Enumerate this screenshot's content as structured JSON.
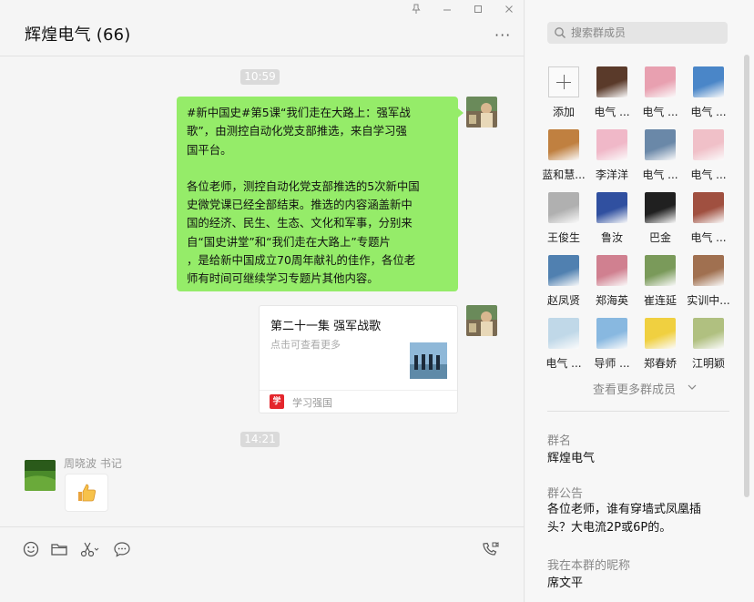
{
  "chat": {
    "title": "辉煌电气 (66)",
    "more_icon": "ellipsis-icon",
    "window_controls": [
      "pin-icon",
      "minimize-icon",
      "maximize-icon",
      "close-icon"
    ],
    "timestamps": [
      "10:59",
      "14:21"
    ],
    "message1": {
      "lines": [
        "#新中国史#第5课“我们走在大路上：强军战",
        "歌”，由测控自动化党支部推选，来自学习强",
        "国平台。",
        "",
        "各位老师，测控自动化党支部推选的5次新中国",
        "史微党课已经全部结束。推选的内容涵盖新中",
        "国的经济、民生、生态、文化和军事，分别来",
        "自“国史讲堂”和“我们走在大路上”专题片",
        "，是给新中国成立70周年献礼的佳作，各位老",
        "师有时间可继续学习专题片其他内容。"
      ]
    },
    "card": {
      "title": "第二十一集 强军战歌",
      "subtitle": "点击可查看更多",
      "source": "学习强国",
      "logo_text": "学"
    },
    "message3": {
      "sender": "周晓波 书记",
      "sticker": "thumbs-up-icon"
    },
    "toolbar_icons": [
      "emoji-icon",
      "folder-icon",
      "scissors-icon",
      "chat-history-icon",
      "video-call-icon"
    ]
  },
  "panel": {
    "search_placeholder": "搜索群成员",
    "add_label": "添加",
    "members": [
      {
        "name": "电气 ...",
        "color": "#5a3a2a"
      },
      {
        "name": "电气 ...",
        "color": "#e8a0b0"
      },
      {
        "name": "电气 ...",
        "color": "#4a86c8"
      },
      {
        "name": "蓝和慧...",
        "color": "#c08040"
      },
      {
        "name": "李洋洋",
        "color": "#f0b8c8"
      },
      {
        "name": "电气 ...",
        "color": "#6a88a8"
      },
      {
        "name": "电气 ...",
        "color": "#f0c0c8"
      },
      {
        "name": "王俊生",
        "color": "#b0b0b0"
      },
      {
        "name": "鲁汝",
        "color": "#3050a0"
      },
      {
        "name": "巴金",
        "color": "#202020"
      },
      {
        "name": "电气 ...",
        "color": "#a05040"
      },
      {
        "name": "赵凤贤",
        "color": "#5080b0"
      },
      {
        "name": "郑海英",
        "color": "#d08090"
      },
      {
        "name": "崔连延",
        "color": "#7a9a5a"
      },
      {
        "name": "实训中...",
        "color": "#a07050"
      },
      {
        "name": "电气 ...",
        "color": "#c0d8e8"
      },
      {
        "name": "导师 ...",
        "color": "#88b8e0"
      },
      {
        "name": "郑春娇",
        "color": "#f0d040"
      },
      {
        "name": "江明颖",
        "color": "#b0c080"
      }
    ],
    "see_more": "查看更多群成员",
    "group_name_label": "群名",
    "group_name": "辉煌电气",
    "notice_label": "群公告",
    "notice_lines": [
      "各位老师，谁有穿墙式凤凰插",
      "头？大电流2P或6P的。"
    ],
    "nickname_label": "我在本群的昵称",
    "nickname": "席文平"
  }
}
